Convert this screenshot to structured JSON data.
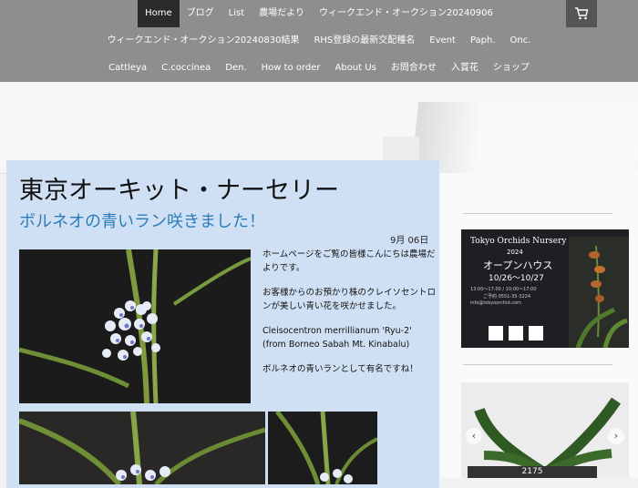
{
  "nav": {
    "row1": [
      "Home",
      "ブログ",
      "List",
      "農場だより",
      "ウィークエンド・オークション20240906"
    ],
    "row2": [
      "ウィークエンド・オークション20240830結果",
      "RHS登録の最新交配種名",
      "Event",
      "Paph.",
      "Onc."
    ],
    "row3": [
      "Cattleya",
      "C.coccinea",
      "Den.",
      "How to order",
      "About Us",
      "お問合わせ",
      "入賞花",
      "ショップ"
    ]
  },
  "header": {
    "site_title": "東京オーキット・ナーセリー",
    "post_title": "ボルネオの青いラン咲きました！",
    "date": "9月 06日"
  },
  "post": {
    "para1": "ホームページをご覧の皆様こんにちは農場だよりです。",
    "para2": "お客様からのお預かり株のクレイソセントロンが美しい青い花を咲かせました。",
    "para3a": "Cleisocentron merrillianum 'Ryu-2'",
    "para3b": "(from Borneo Sabah Mt. Kinabalu)",
    "para4": "ボルネオの青いランとして有名ですね！"
  },
  "sidebar": {
    "poster": {
      "title": "Tokyo Orchids Nursery",
      "year": "2024",
      "heading": "オープンハウス",
      "dates": "10/26〜10/27",
      "line1": "13:00〜17:00 / 10:00〜17:00",
      "line2": "ご予約 0551-35-3224",
      "line3": "info@tokyoorchid.com"
    },
    "slide_caption": "2175",
    "prev_arrow": "‹",
    "next_arrow": "›"
  }
}
